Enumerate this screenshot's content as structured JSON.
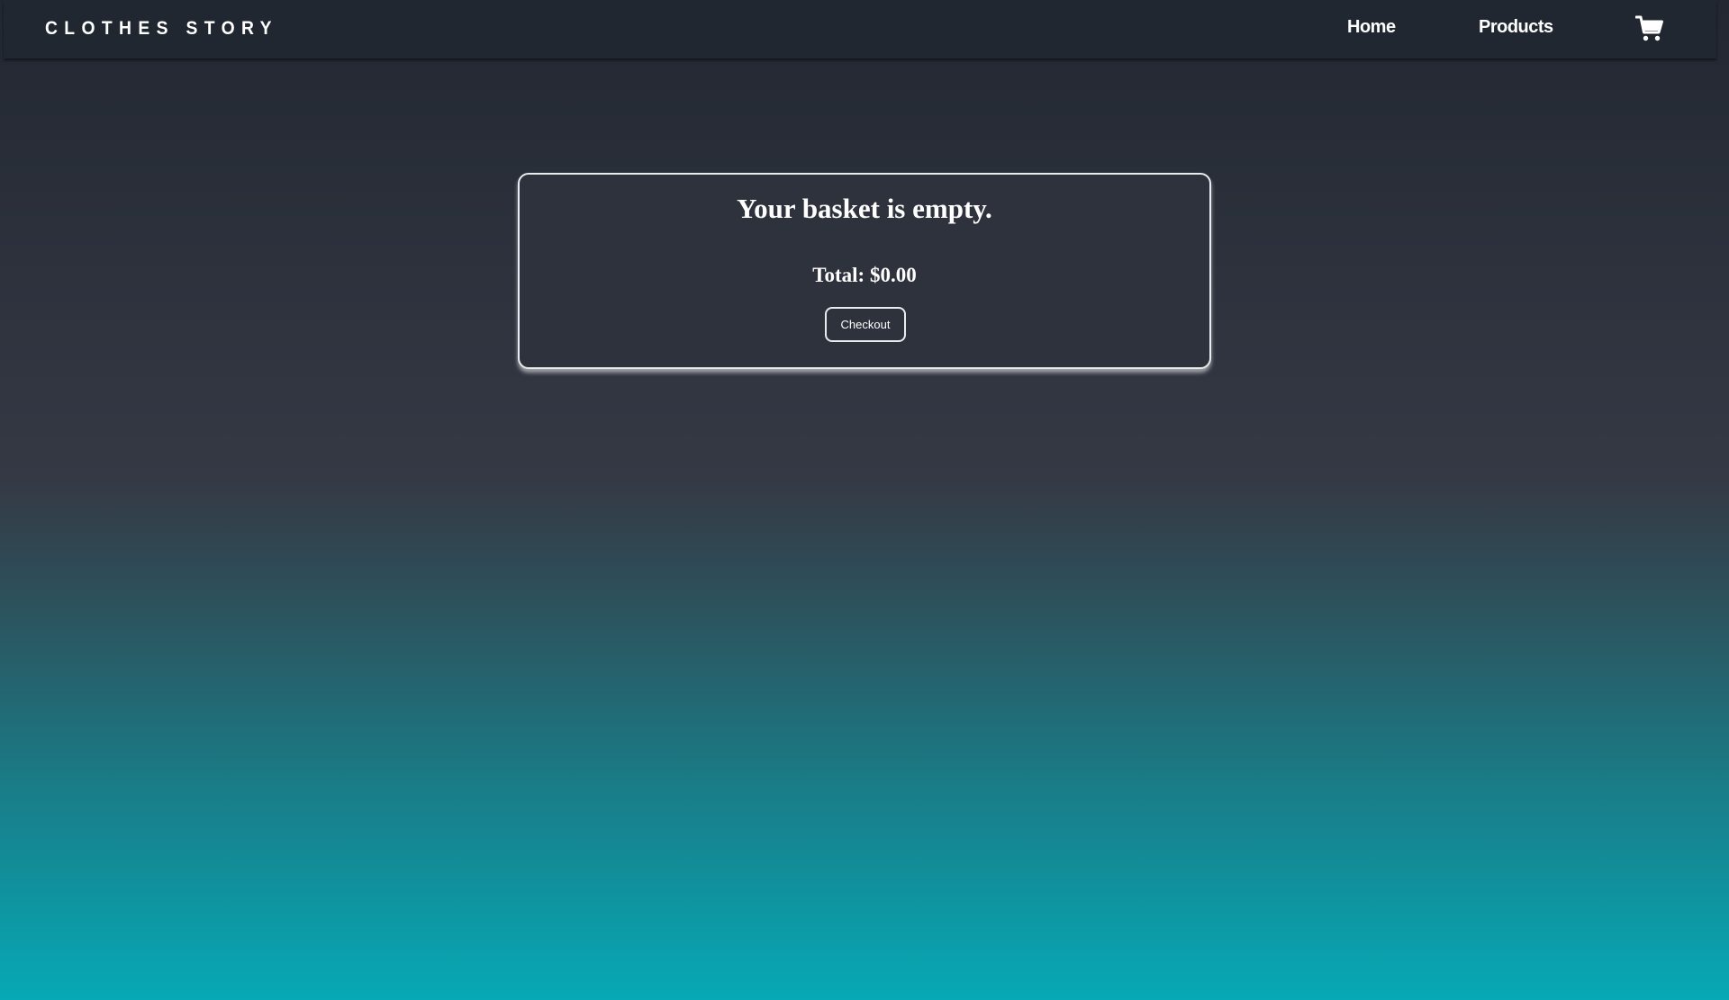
{
  "navbar": {
    "brand": "CLOTHES STORY",
    "links": [
      {
        "label": "Home"
      },
      {
        "label": "Products"
      }
    ],
    "cart_icon": "shopping-cart-icon"
  },
  "basket": {
    "title": "Your basket is empty.",
    "total": "Total: $0.00",
    "checkout_label": "Checkout"
  },
  "colors": {
    "navbar_bg": "#212730",
    "card_bg": "#2e323d",
    "gradient_bottom": "#06a9b5",
    "text": "#ffffff"
  }
}
